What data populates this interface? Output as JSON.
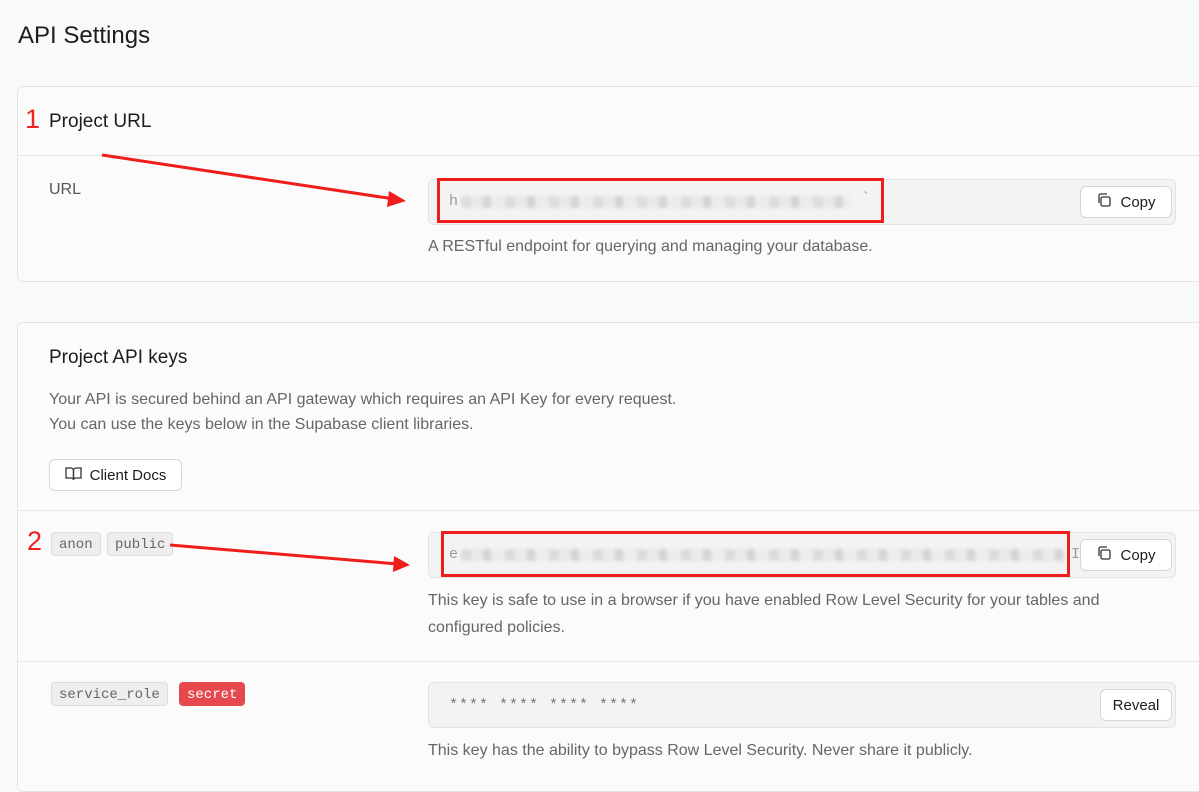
{
  "page": {
    "title": "API Settings"
  },
  "project_url": {
    "section_title": "Project URL",
    "field_label": "URL",
    "value_prefix": "h",
    "value_suffix": "`",
    "copy_label": "Copy",
    "description": "A RESTful endpoint for querying and managing your database."
  },
  "api_keys": {
    "section_title": "Project API keys",
    "intro_line1": "Your API is secured behind an API gateway which requires an API Key for every request.",
    "intro_line2": "You can use the keys below in the Supabase client libraries.",
    "client_docs_label": "Client Docs",
    "anon": {
      "tags": [
        "anon",
        "public"
      ],
      "value_prefix": "e",
      "value_suffix": "I",
      "copy_label": "Copy",
      "description_line1": "This key is safe to use in a browser if you have enabled Row Level Security for your tables and",
      "description_line2": "configured policies."
    },
    "service_role": {
      "tags": [
        "service_role",
        "secret"
      ],
      "masked_value": "**** **** **** ****",
      "reveal_label": "Reveal",
      "description": "This key has the ability to bypass Row Level Security. Never share it publicly."
    }
  },
  "annotations": {
    "marker_1": "1",
    "marker_2": "2",
    "color": "#f01d1d"
  },
  "icons": {
    "copy": "copy-icon",
    "docs": "book-open-icon"
  }
}
